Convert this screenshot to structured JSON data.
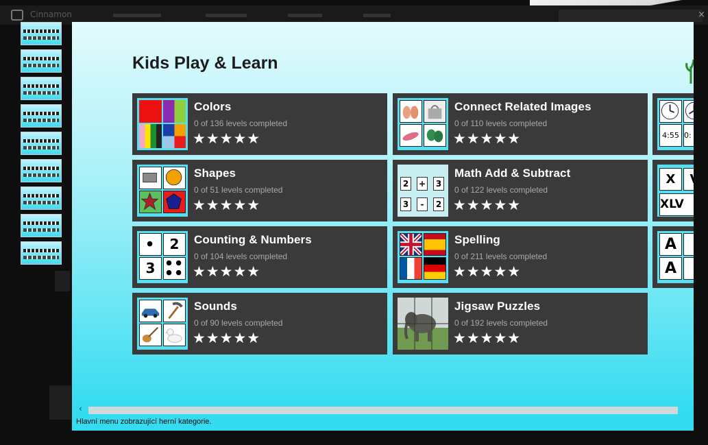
{
  "window": {
    "app_title": "Cinnamon",
    "close": "×"
  },
  "page": {
    "title": "Kids Play & Learn"
  },
  "categories": [
    {
      "name": "Colors",
      "progress": "0 of 136 levels completed",
      "stars": "★★★★★"
    },
    {
      "name": "Connect Related Images",
      "progress": "0 of 110 levels completed",
      "stars": "★★★★★"
    },
    {
      "name": "Shapes",
      "progress": "0 of 51 levels completed",
      "stars": "★★★★★"
    },
    {
      "name": "Math Add & Subtract",
      "progress": "0 of 122 levels completed",
      "stars": "★★★★★"
    },
    {
      "name": "Counting & Numbers",
      "progress": "0 of 104 levels completed",
      "stars": "★★★★★"
    },
    {
      "name": "Spelling",
      "progress": "0 of 211 levels completed",
      "stars": "★★★★★"
    },
    {
      "name": "Sounds",
      "progress": "0 of 90 levels completed",
      "stars": "★★★★★"
    },
    {
      "name": "Jigsaw Puzzles",
      "progress": "0 of 192 levels completed",
      "stars": "★★★★★"
    }
  ],
  "icon_text": {
    "counting": [
      "2",
      "3"
    ],
    "math": [
      "2",
      "+",
      "3",
      "3",
      "-",
      "2"
    ],
    "partial_clock": "4:55",
    "partial_clock2": "0:",
    "partial_roman_1": "X",
    "partial_roman_2": "V",
    "partial_roman_3": "XLV",
    "partial_letter_1": "A",
    "partial_letter_2": "A"
  },
  "status_bar": {
    "text": "Hlavní menu zobrazující herní kategorie."
  },
  "scroll": {
    "left_arrow": "‹"
  },
  "colors": {
    "accent": "#35dbef",
    "tile": "#3a3a3a"
  }
}
